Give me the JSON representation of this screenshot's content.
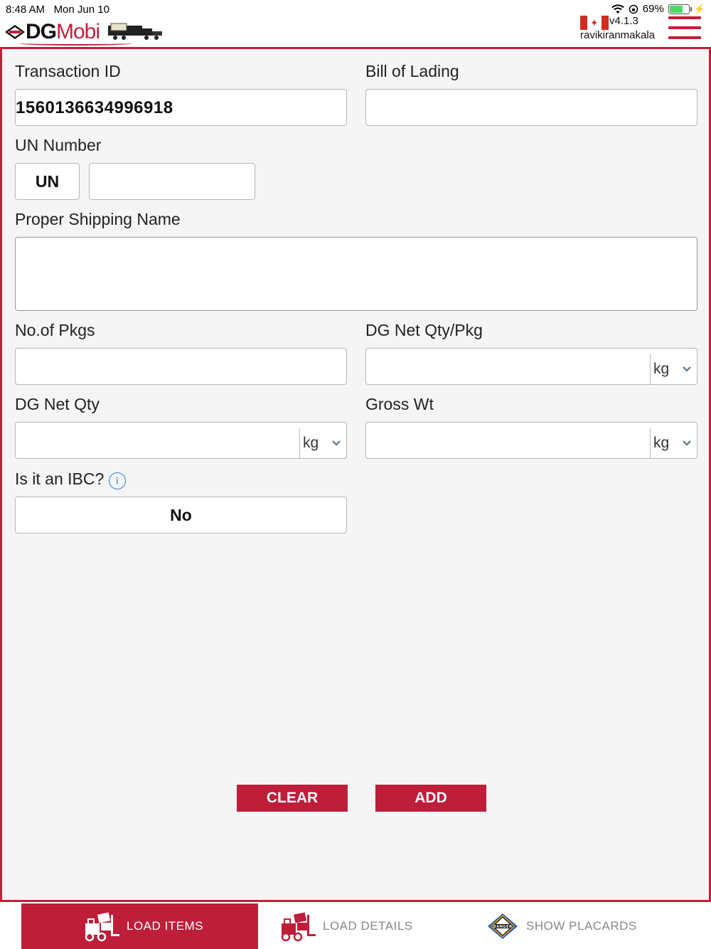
{
  "status_bar": {
    "time": "8:48 AM",
    "date": "Mon Jun 10",
    "battery": "69%",
    "battery_level": 0.69
  },
  "header": {
    "logo_dg": "DG",
    "logo_mobi": "Mobi",
    "version": "v4.1.3",
    "username": "ravikiranmakala",
    "menu_icon": "hamburger-icon",
    "flag_icon": "canada-flag-icon"
  },
  "form": {
    "transaction_id": {
      "label": "Transaction ID",
      "value": "1560136634996918"
    },
    "bill_of_lading": {
      "label": "Bill of Lading",
      "value": ""
    },
    "un_number": {
      "label": "UN Number",
      "prefix": "UN",
      "value": ""
    },
    "proper_shipping_name": {
      "label": "Proper Shipping Name",
      "value": ""
    },
    "no_of_pkgs": {
      "label": "No.of Pkgs",
      "value": ""
    },
    "dg_net_qty_pkg": {
      "label": "DG Net Qty/Pkg",
      "value": "",
      "unit": "kg"
    },
    "dg_net_qty": {
      "label": "DG Net Qty",
      "value": "",
      "unit": "kg"
    },
    "gross_wt": {
      "label": "Gross Wt",
      "value": "",
      "unit": "kg"
    },
    "ibc": {
      "label": "Is it an IBC?",
      "value": "No",
      "info_icon": "info-icon"
    }
  },
  "actions": {
    "clear": "CLEAR",
    "add": "ADD"
  },
  "tabs": [
    {
      "label": "LOAD ITEMS",
      "icon": "forklift-icon",
      "active": true
    },
    {
      "label": "LOAD DETAILS",
      "icon": "forklift-icon",
      "active": false
    },
    {
      "label": "SHOW PLACARDS",
      "icon": "danger-placard-icon",
      "active": false
    }
  ],
  "colors": {
    "accent": "#be1e3a",
    "background": "#f4f5f4",
    "info": "#2f7fe0"
  }
}
